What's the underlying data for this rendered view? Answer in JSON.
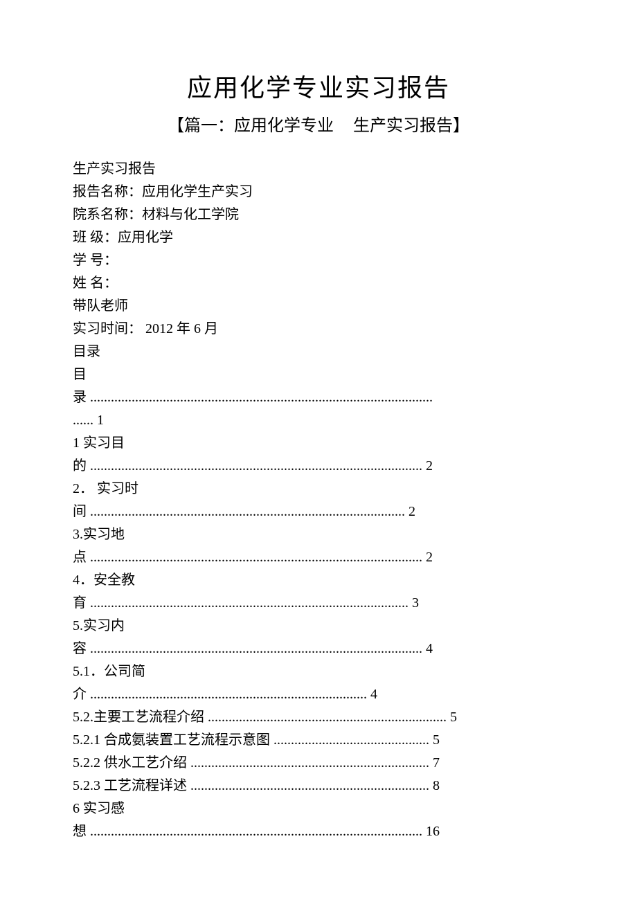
{
  "title": "应用化学专业实习报告",
  "subtitle_left": "【篇一：应用化学专业",
  "subtitle_right": "生产实习报告】",
  "lines": {
    "l1": " 生产实习报告",
    "l2": " 报告名称：应用化学生产实习",
    "l3": " 院系名称：材料与化工学院",
    "l4": " 班 级：应用化学",
    "l5": " 学 号：",
    "l6": " 姓 名：",
    "l7": " 带队老师",
    "l8": " 实习时间： 2012 年 6 月",
    "l9": " 目录",
    "l10a": " 目",
    "l10b": "录 ...................................................................................................",
    "l10c": "...... 1",
    "l11a": " 1 实习目",
    "l11b": "的 ................................................................................................ 2",
    "l12a": " 2． 实习时",
    "l12b": "间 ........................................................................................... 2",
    "l13a": " 3.实习地",
    "l13b": "点 ................................................................................................ 2",
    "l14a": " 4．安全教",
    "l14b": "育 ............................................................................................ 3",
    "l15a": " 5.实习内",
    "l15b": "容 ................................................................................................ 4",
    "l16a": " 5.1．公司简",
    "l16b": "介 ................................................................................ 4",
    "l17": " 5.2.主要工艺流程介绍   ..................................................................... 5",
    "l18": " 5.2.1  合成氨装置工艺流程示意图    ............................................. 5",
    "l19": " 5.2.2  供水工艺介绍    ..................................................................... 7",
    "l20": " 5.2.3  工艺流程详述    ..................................................................... 8",
    "l21a": " 6 实习感",
    "l21b": "想 ................................................................................................ 16"
  }
}
